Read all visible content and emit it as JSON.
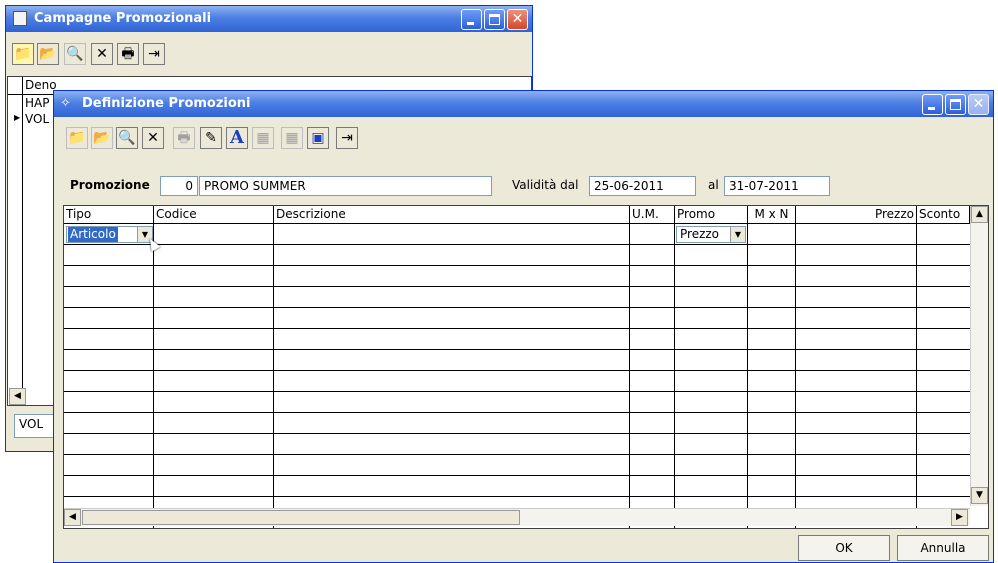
{
  "back_window": {
    "title": "Campagne Promozionali",
    "grid_header": "Deno",
    "rows": [
      "HAP",
      "VOL"
    ],
    "footer_field": "VOL"
  },
  "front_window": {
    "title": "Definizione Promozioni",
    "promozione_label": "Promozione",
    "promozione_number": "0",
    "promozione_name": "PROMO SUMMER",
    "validita_label": "Validità dal",
    "date_from": "25-06-2011",
    "al_label": "al",
    "date_to": "31-07-2011",
    "columns": [
      "Tipo",
      "Codice",
      "Descrizione",
      "U.M.",
      "Promo",
      "M x N",
      "Prezzo",
      "Sconto"
    ],
    "row1": {
      "tipo": "Articolo",
      "promo": "Prezzo"
    },
    "ok_label": "OK",
    "annulla_label": "Annulla"
  },
  "icons": {
    "folder_new": "📁",
    "folder_open": "📂",
    "find": "🔍",
    "delete": "✕",
    "print": "🖶",
    "edit": "✎",
    "font": "A",
    "exit": "⇥",
    "save": "▣",
    "grid": "▦"
  }
}
